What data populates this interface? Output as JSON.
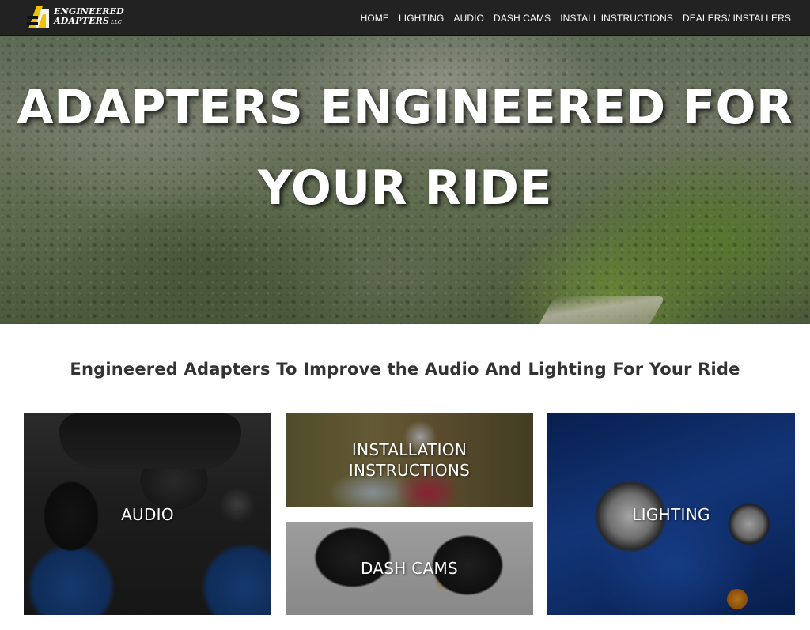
{
  "header": {
    "logo_line1": "ENGINEERED",
    "logo_line2": "ADAPTERS",
    "logo_suffix": "LLC",
    "nav": [
      {
        "label": "HOME"
      },
      {
        "label": "LIGHTING"
      },
      {
        "label": "AUDIO"
      },
      {
        "label": "DASH CAMS"
      },
      {
        "label": "INSTALL INSTRUCTIONS"
      },
      {
        "label": "DEALERS/ INSTALLERS"
      }
    ]
  },
  "hero": {
    "line1": "ADAPTERS ENGINEERED FOR",
    "line2": "YOUR RIDE"
  },
  "subtitle": "Engineered Adapters To Improve the Audio And Lighting For Your Ride",
  "tiles": {
    "audio": "AUDIO",
    "install_line1": "INSTALLATION",
    "install_line2": "INSTRUCTIONS",
    "dash": "DASH CAMS",
    "lighting": "LIGHTING"
  },
  "colors": {
    "header_bg": "#222222",
    "logo_accent": "#f2c200",
    "subtitle_text": "#333333"
  }
}
